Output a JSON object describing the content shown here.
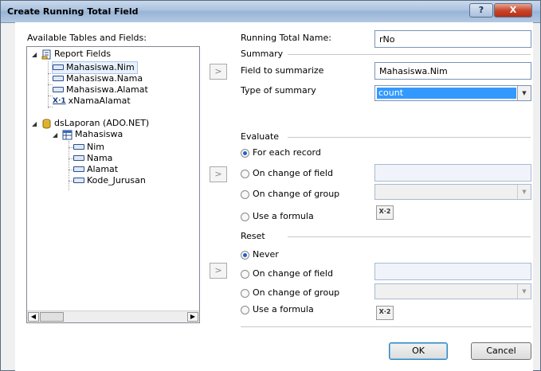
{
  "window": {
    "title": "Create Running Total Field",
    "help_label": "?",
    "close_label": "X"
  },
  "left": {
    "label": "Available Tables and Fields:",
    "tree": {
      "report_fields": "Report Fields",
      "report_items": [
        "Mahasiswa.Nim",
        "Mahasiswa.Nama",
        "Mahasiswa.Alamat",
        "xNamaAlamat"
      ],
      "formula_icon": "X·1",
      "dataset": "dsLaporan (ADO.NET)",
      "table": "Mahasiswa",
      "table_fields": [
        "Nim",
        "Nama",
        "Alamat",
        "Kode_Jurusan"
      ],
      "selected": "Mahasiswa.Nim"
    }
  },
  "running_total_name": {
    "label": "Running Total Name:",
    "value": "rNo"
  },
  "summary": {
    "label": "Summary",
    "field_label": "Field to summarize",
    "field_value": "Mahasiswa.Nim",
    "type_label": "Type of summary",
    "type_value": "count"
  },
  "evaluate": {
    "label": "Evaluate",
    "options": [
      "For each record",
      "On change of field",
      "On change of group",
      "Use a formula"
    ],
    "selected": "For each record"
  },
  "reset": {
    "label": "Reset",
    "options": [
      "Never",
      "On change of field",
      "On change of group",
      "Use a formula"
    ],
    "selected": "Never"
  },
  "formula_button_label": "X·2",
  "arrow_label": ">",
  "buttons": {
    "ok": "OK",
    "cancel": "Cancel"
  }
}
